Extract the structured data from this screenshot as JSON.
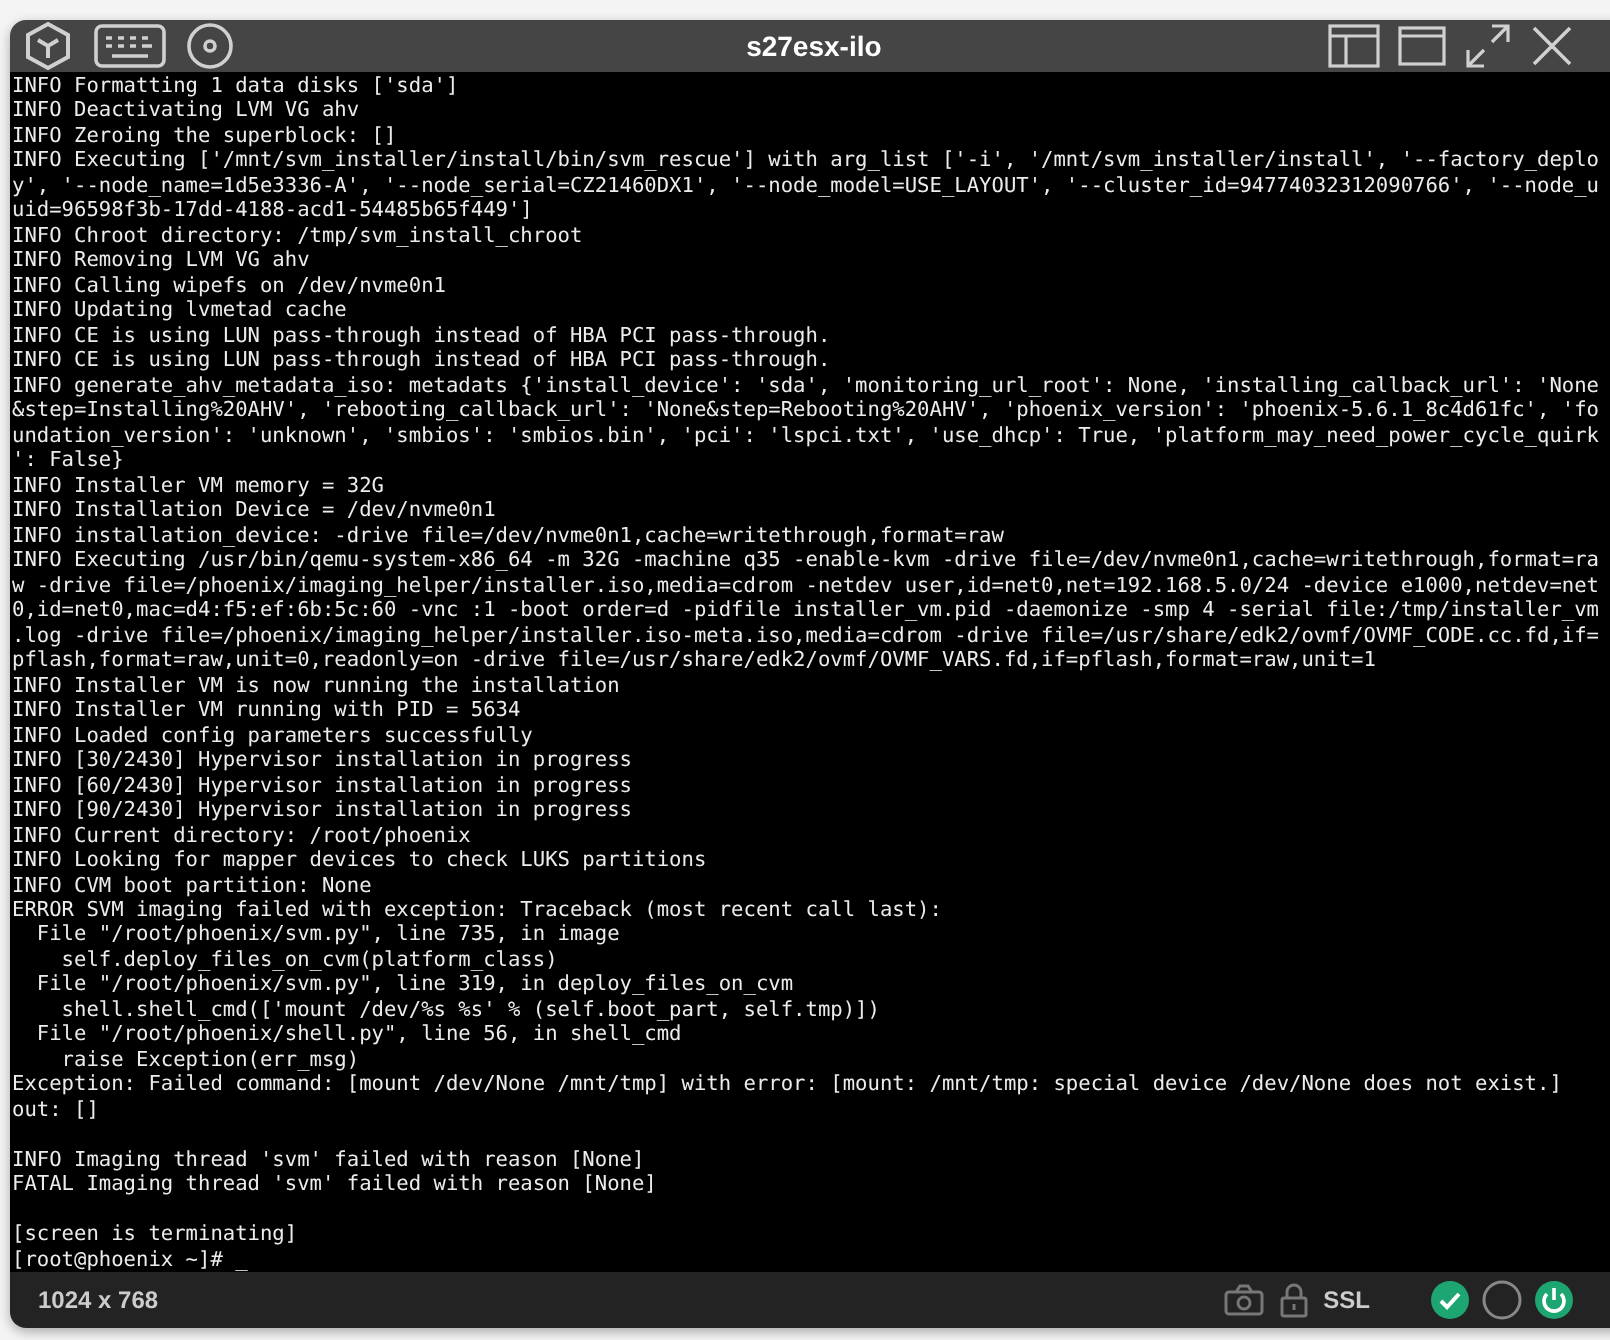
{
  "window": {
    "title": "s27esx-ilo"
  },
  "console": {
    "blocks": [
      [
        "INFO Formatting 1 data disks ['sda']",
        "INFO Deactivating LVM VG ahv",
        "INFO Zeroing the superblock: []",
        "INFO Executing ['/mnt/svm_installer/install/bin/svm_rescue'] with arg_list ['-i', '/mnt/svm_installer/install', '--factory_deplo",
        "y', '--node_name=1d5e3336-A', '--node_serial=CZ21460DX1', '--node_model=USE_LAYOUT', '--cluster_id=94774032312090766', '--node_u",
        "uid=96598f3b-17dd-4188-acd1-54485b65f449']",
        "INFO Chroot directory: /tmp/svm_install_chroot",
        "INFO Removing LVM VG ahv",
        "INFO Calling wipefs on /dev/nvme0n1",
        "INFO Updating lvmetad cache",
        "INFO CE is using LUN pass-through instead of HBA PCI pass-through.",
        "INFO CE is using LUN pass-through instead of HBA PCI pass-through.",
        "INFO generate_ahv_metadata_iso: metadats {'install_device': 'sda', 'monitoring_url_root': None, 'installing_callback_url': 'None",
        "&step=Installing%20AHV', 'rebooting_callback_url': 'None&step=Rebooting%20AHV', 'phoenix_version': 'phoenix-5.6.1_8c4d61fc', 'fo",
        "undation_version': 'unknown', 'smbios': 'smbios.bin', 'pci': 'lspci.txt', 'use_dhcp': True, 'platform_may_need_power_cycle_quirk",
        "': False}",
        "INFO Installer VM memory = 32G",
        "INFO Installation Device = /dev/nvme0n1",
        "INFO installation_device: -drive file=/dev/nvme0n1,cache=writethrough,format=raw",
        "INFO Executing /usr/bin/qemu-system-x86_64 -m 32G -machine q35 -enable-kvm -drive file=/dev/nvme0n1,cache=writethrough,format=ra",
        "w -drive file=/phoenix/imaging_helper/installer.iso,media=cdrom -netdev user,id=net0,net=192.168.5.0/24 -device e1000,netdev=net",
        "0,id=net0,mac=d4:f5:ef:6b:5c:60 -vnc :1 -boot order=d -pidfile installer_vm.pid -daemonize -smp 4 -serial file:/tmp/installer_vm",
        ".log -drive file=/phoenix/imaging_helper/installer.iso-meta.iso,media=cdrom -drive file=/usr/share/edk2/ovmf/OVMF_CODE.cc.fd,if=",
        "pflash,format=raw,unit=0,readonly=on -drive file=/usr/share/edk2/ovmf/OVMF_VARS.fd,if=pflash,format=raw,unit=1",
        "INFO Installer VM is now running the installation",
        "INFO Installer VM running with PID = 5634",
        "INFO Loaded config parameters successfully",
        "INFO [30/2430] Hypervisor installation in progress",
        "INFO [60/2430] Hypervisor installation in progress",
        "INFO [90/2430] Hypervisor installation in progress",
        "INFO Current directory: /root/phoenix",
        "INFO Looking for mapper devices to check LUKS partitions",
        "INFO CVM boot partition: None",
        "ERROR SVM imaging failed with exception: Traceback (most recent call last):",
        "  File \"/root/phoenix/svm.py\", line 735, in image",
        "    self.deploy_files_on_cvm(platform_class)",
        "  File \"/root/phoenix/svm.py\", line 319, in deploy_files_on_cvm",
        "    shell.shell_cmd(['mount /dev/%s %s' % (self.boot_part, self.tmp)])",
        "  File \"/root/phoenix/shell.py\", line 56, in shell_cmd",
        "    raise Exception(err_msg)",
        "Exception: Failed command: [mount /dev/None /mnt/tmp] with error: [mount: /mnt/tmp: special device /dev/None does not exist.]",
        "out: []"
      ],
      [
        "INFO Imaging thread 'svm' failed with reason [None]",
        "FATAL Imaging thread 'svm' failed with reason [None]"
      ],
      [
        "[screen is terminating]",
        "[root@phoenix ~]# _"
      ]
    ]
  },
  "status_bar": {
    "resolution": "1024 x 768",
    "encryption": "SSL",
    "indicators": [
      {
        "kind": "ok"
      },
      {
        "kind": "idle"
      },
      {
        "kind": "power"
      }
    ]
  }
}
